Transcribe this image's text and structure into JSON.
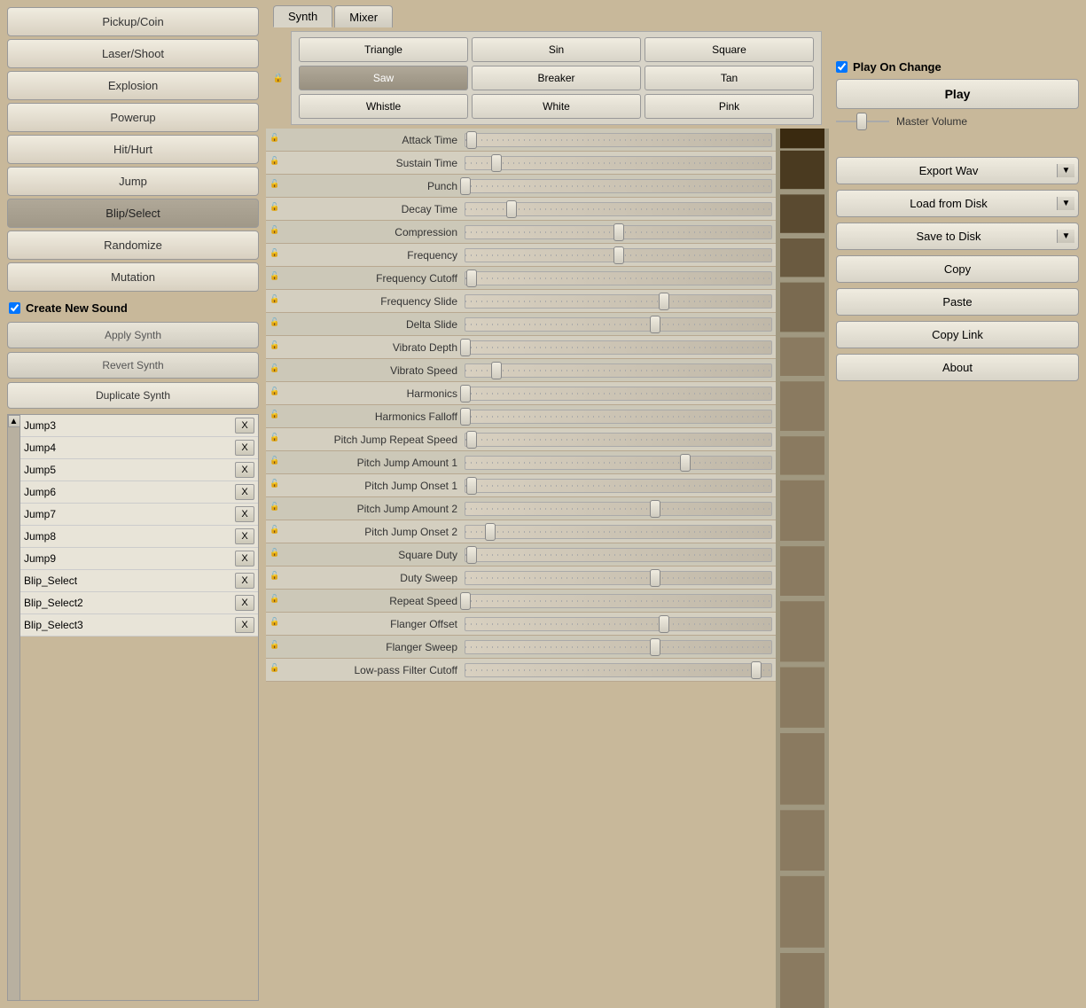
{
  "presets": {
    "items": [
      {
        "id": "pickup-coin",
        "label": "Pickup/Coin"
      },
      {
        "id": "laser-shoot",
        "label": "Laser/Shoot"
      },
      {
        "id": "explosion",
        "label": "Explosion"
      },
      {
        "id": "powerup",
        "label": "Powerup"
      },
      {
        "id": "hit-hurt",
        "label": "Hit/Hurt"
      },
      {
        "id": "jump",
        "label": "Jump"
      },
      {
        "id": "blip-select",
        "label": "Blip/Select",
        "selected": true
      },
      {
        "id": "randomize",
        "label": "Randomize"
      },
      {
        "id": "mutation",
        "label": "Mutation"
      }
    ]
  },
  "create_new_sound": {
    "label": "Create New Sound",
    "checked": true
  },
  "apply_synth": {
    "label": "Apply Synth"
  },
  "revert_synth": {
    "label": "Revert Synth"
  },
  "duplicate_synth": {
    "label": "Duplicate Synth"
  },
  "synth_list": {
    "items": [
      {
        "name": "Jump3"
      },
      {
        "name": "Jump4"
      },
      {
        "name": "Jump5"
      },
      {
        "name": "Jump6"
      },
      {
        "name": "Jump7"
      },
      {
        "name": "Jump8"
      },
      {
        "name": "Jump9"
      },
      {
        "name": "Blip_Select"
      },
      {
        "name": "Blip_Select2"
      },
      {
        "name": "Blip_Select3"
      }
    ],
    "delete_label": "X",
    "scroll_up": "▲"
  },
  "tabs": [
    {
      "id": "synth",
      "label": "Synth",
      "active": true
    },
    {
      "id": "mixer",
      "label": "Mixer"
    }
  ],
  "wave_buttons": [
    {
      "id": "triangle",
      "label": "Triangle"
    },
    {
      "id": "sin",
      "label": "Sin"
    },
    {
      "id": "square",
      "label": "Square"
    },
    {
      "id": "saw",
      "label": "Saw",
      "selected": true
    },
    {
      "id": "breaker",
      "label": "Breaker"
    },
    {
      "id": "tan",
      "label": "Tan"
    },
    {
      "id": "whistle",
      "label": "Whistle"
    },
    {
      "id": "white",
      "label": "White"
    },
    {
      "id": "pink",
      "label": "Pink"
    }
  ],
  "params": [
    {
      "id": "attack-time",
      "label": "Attack Time",
      "value": 0.02,
      "locked": false
    },
    {
      "id": "sustain-time",
      "label": "Sustain Time",
      "value": 0.1,
      "locked": false
    },
    {
      "id": "punch",
      "label": "Punch",
      "value": 0.0,
      "locked": false
    },
    {
      "id": "decay-time",
      "label": "Decay Time",
      "value": 0.15,
      "locked": false
    },
    {
      "id": "compression",
      "label": "Compression",
      "value": 0.5,
      "locked": false
    },
    {
      "id": "frequency",
      "label": "Frequency",
      "value": 0.5,
      "locked": false
    },
    {
      "id": "frequency-cutoff",
      "label": "Frequency Cutoff",
      "value": 0.02,
      "locked": false
    },
    {
      "id": "frequency-slide",
      "label": "Frequency Slide",
      "value": 0.65,
      "locked": false
    },
    {
      "id": "delta-slide",
      "label": "Delta Slide",
      "value": 0.62,
      "locked": false
    },
    {
      "id": "vibrato-depth",
      "label": "Vibrato Depth",
      "value": 0.0,
      "locked": false
    },
    {
      "id": "vibrato-speed",
      "label": "Vibrato Speed",
      "value": 0.1,
      "locked": false
    },
    {
      "id": "harmonics",
      "label": "Harmonics",
      "value": 0.0,
      "locked": false
    },
    {
      "id": "harmonics-falloff",
      "label": "Harmonics Falloff",
      "value": 0.0,
      "locked": false
    },
    {
      "id": "pitch-jump-repeat-speed",
      "label": "Pitch Jump Repeat Speed",
      "value": 0.02,
      "locked": false
    },
    {
      "id": "pitch-jump-amount-1",
      "label": "Pitch Jump Amount 1",
      "value": 0.72,
      "locked": false
    },
    {
      "id": "pitch-jump-onset-1",
      "label": "Pitch Jump Onset 1",
      "value": 0.02,
      "locked": false
    },
    {
      "id": "pitch-jump-amount-2",
      "label": "Pitch Jump Amount 2",
      "value": 0.62,
      "locked": false
    },
    {
      "id": "pitch-jump-onset-2",
      "label": "Pitch Jump Onset 2",
      "value": 0.08,
      "locked": false
    },
    {
      "id": "square-duty",
      "label": "Square Duty",
      "value": 0.02,
      "locked": false
    },
    {
      "id": "duty-sweep",
      "label": "Duty Sweep",
      "value": 0.62,
      "locked": false
    },
    {
      "id": "repeat-speed",
      "label": "Repeat Speed",
      "value": 0.0,
      "locked": false
    },
    {
      "id": "flanger-offset",
      "label": "Flanger Offset",
      "value": 0.65,
      "locked": false
    },
    {
      "id": "flanger-sweep",
      "label": "Flanger Sweep",
      "value": 0.62,
      "locked": false
    },
    {
      "id": "low-pass-filter-cutoff",
      "label": "Low-pass Filter Cutoff",
      "value": 0.95,
      "locked": false
    }
  ],
  "scroll_up": "▲",
  "scroll_down": "▼",
  "right_panel": {
    "play_on_change": {
      "label": "Play On Change",
      "checked": true
    },
    "play_btn": "Play",
    "master_volume_label": "Master Volume",
    "master_volume_value": 0.5,
    "export_wav": "Export Wav",
    "load_from_disk": "Load from Disk",
    "save_to_disk": "Save to Disk",
    "copy": "Copy",
    "paste": "Paste",
    "copy_link": "Copy Link",
    "about": "About",
    "dropdown_arrow": "▼"
  }
}
